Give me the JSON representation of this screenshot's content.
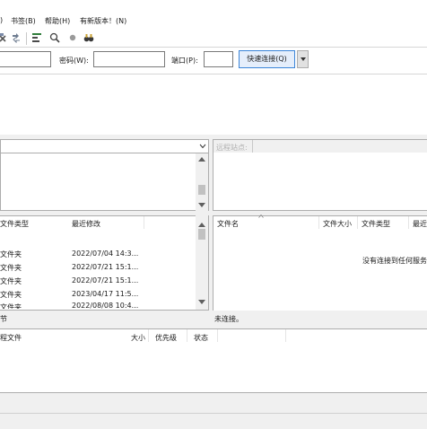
{
  "menu": {
    "right_paren": ")",
    "bookmarks": "书签(B)",
    "help": "帮助(H)",
    "new_version": "有新版本！(N)"
  },
  "quickconnect": {
    "password_label": "密码(W):",
    "port_label": "端口(P):",
    "connect_button": "快速连接(Q)"
  },
  "remote_site": {
    "label": "远程站点:"
  },
  "local_files": {
    "headers": [
      "文件类型",
      "最近修改"
    ],
    "rows": [
      {
        "type": "文件夹",
        "modified": "2022/07/04 14:3..."
      },
      {
        "type": "文件夹",
        "modified": "2022/07/21 15:1..."
      },
      {
        "type": "文件夹",
        "modified": "2022/07/21 15:1..."
      },
      {
        "type": "文件夹",
        "modified": "2023/04/17 11:5..."
      },
      {
        "type": "文件夹",
        "modified": "2022/08/08 10:4..."
      }
    ],
    "status": "节"
  },
  "remote_files": {
    "headers": [
      "文件名",
      "文件大小",
      "文件类型",
      "最近"
    ],
    "empty_message": "没有连接到任何服务",
    "status": "未连接。"
  },
  "queue": {
    "headers": [
      "程文件",
      "大小",
      "优先级",
      "状态"
    ]
  },
  "colors": {
    "accent": "#3b85d8",
    "panel_bg": "#f0f0f0"
  },
  "icons": [
    "close-icon",
    "sync-icon",
    "filter-icon",
    "search-icon",
    "stop-icon",
    "binoculars-icon"
  ]
}
